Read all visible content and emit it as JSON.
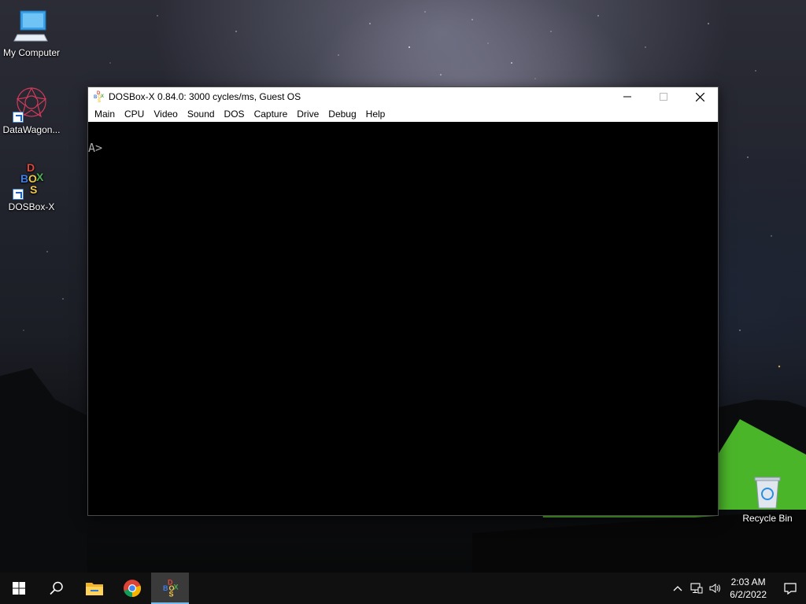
{
  "desktop": {
    "icons": [
      {
        "label": "My Computer",
        "icon": "monitor-icon"
      },
      {
        "label": "DataWagon...",
        "icon": "datawagon-icon"
      },
      {
        "label": "DOSBox-X",
        "icon": "dosbox-icon"
      },
      {
        "label": "Recycle Bin",
        "icon": "recycle-bin-icon"
      }
    ]
  },
  "window": {
    "title": "DOSBox-X 0.84.0: 3000 cycles/ms, Guest OS",
    "menu": [
      "Main",
      "CPU",
      "Video",
      "Sound",
      "DOS",
      "Capture",
      "Drive",
      "Debug",
      "Help"
    ],
    "console_prompt": "A>"
  },
  "taskbar": {
    "buttons": [
      "start-icon",
      "search-icon",
      "file-explorer-icon",
      "chrome-icon",
      "dosbox-icon"
    ],
    "clock_time": "2:03 AM",
    "clock_date": "6/2/2022"
  },
  "colors": {
    "accent": "#76b9ed",
    "taskbar": "#101010",
    "console_text": "#aaaaaa"
  }
}
